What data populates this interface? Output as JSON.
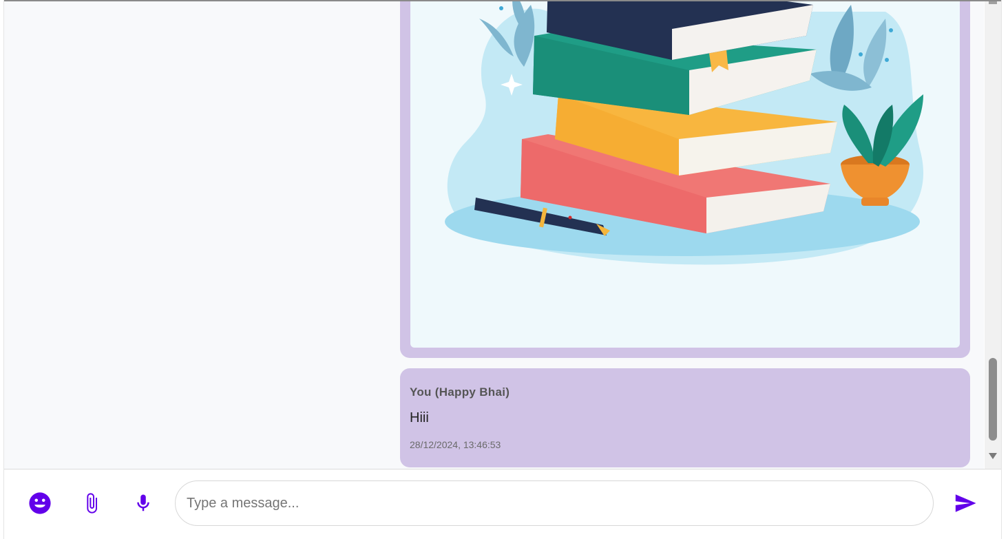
{
  "messages": [
    {
      "type": "image",
      "image_alt": "Stack of colorful books with a pen and potted plant"
    },
    {
      "type": "text",
      "sender": "You (Happy Bhai)",
      "text": "Hiii",
      "timestamp": "28/12/2024, 13:46:53"
    }
  ],
  "composer": {
    "placeholder": "Type a message...",
    "value": "",
    "icons": [
      "emoji-icon",
      "attachment-icon",
      "microphone-icon",
      "send-icon"
    ]
  },
  "colors": {
    "accent": "#6200ea",
    "bubble": "#d0c3e6",
    "chat_background": "#f8f9fb"
  }
}
